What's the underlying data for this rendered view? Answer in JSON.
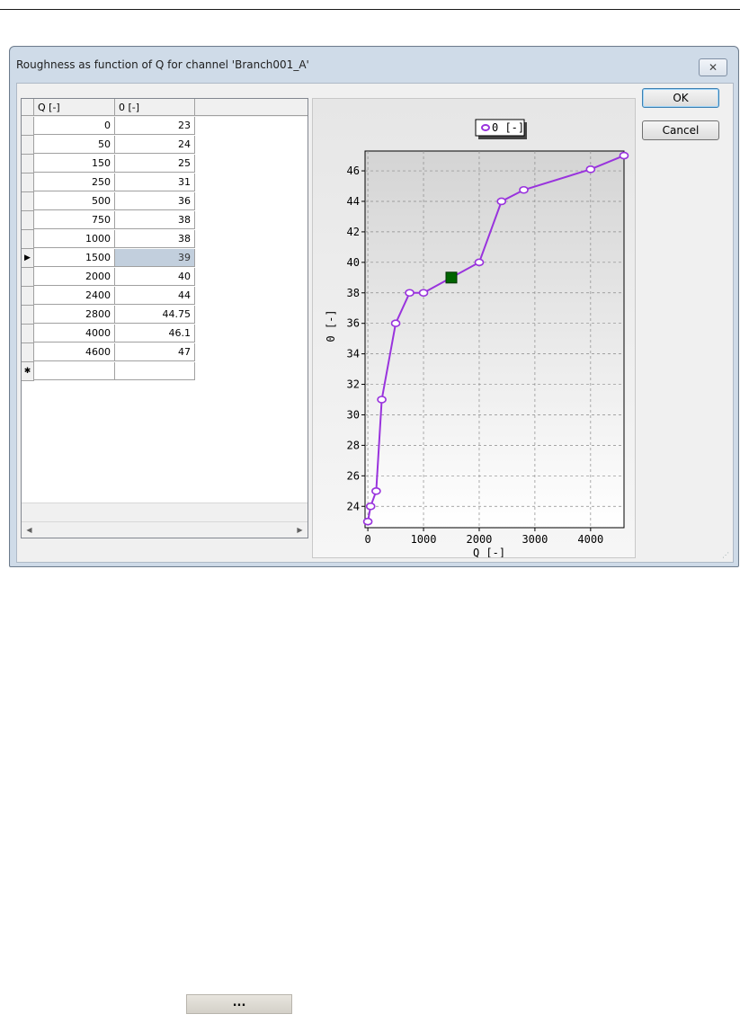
{
  "window": {
    "title": "Roughness as function of Q for channel 'Branch001_A'",
    "close_glyph": "✕"
  },
  "buttons": {
    "ok": "OK",
    "cancel": "Cancel"
  },
  "grid": {
    "columns": [
      "Q [-]",
      "0 [-]"
    ],
    "rows": [
      {
        "q": "0",
        "v": "23"
      },
      {
        "q": "50",
        "v": "24"
      },
      {
        "q": "150",
        "v": "25"
      },
      {
        "q": "250",
        "v": "31"
      },
      {
        "q": "500",
        "v": "36"
      },
      {
        "q": "750",
        "v": "38"
      },
      {
        "q": "1000",
        "v": "38"
      },
      {
        "q": "1500",
        "v": "39"
      },
      {
        "q": "2000",
        "v": "40"
      },
      {
        "q": "2400",
        "v": "44"
      },
      {
        "q": "2800",
        "v": "44.75"
      },
      {
        "q": "4000",
        "v": "46.1"
      },
      {
        "q": "4600",
        "v": "47"
      }
    ],
    "current_row_marker": "▶",
    "new_row_marker": "✱",
    "selected_row": 7
  },
  "chart_data": {
    "type": "line",
    "xlabel": "Q [-]",
    "ylabel": "0 [-]",
    "legend": [
      "0 [-]"
    ],
    "series": [
      {
        "name": "0 [-]",
        "color": "#9933dd",
        "x": [
          0,
          50,
          150,
          250,
          500,
          750,
          1000,
          1500,
          2000,
          2400,
          2800,
          4000,
          4600
        ],
        "y": [
          23,
          24,
          25,
          31,
          36,
          38,
          38,
          39,
          40,
          44,
          44.75,
          46.1,
          47
        ]
      }
    ],
    "selected_point_index": 7,
    "selected_color": "#006400",
    "xlim": [
      -50,
      4600
    ],
    "ylim": [
      22.6,
      47.3
    ],
    "xticks": [
      0,
      1000,
      2000,
      3000,
      4000
    ],
    "yticks": [
      24,
      26,
      28,
      30,
      32,
      34,
      36,
      38,
      40,
      42,
      44,
      46
    ],
    "grid": true,
    "legend_position": "top"
  },
  "extra_button": {
    "label": "..."
  }
}
